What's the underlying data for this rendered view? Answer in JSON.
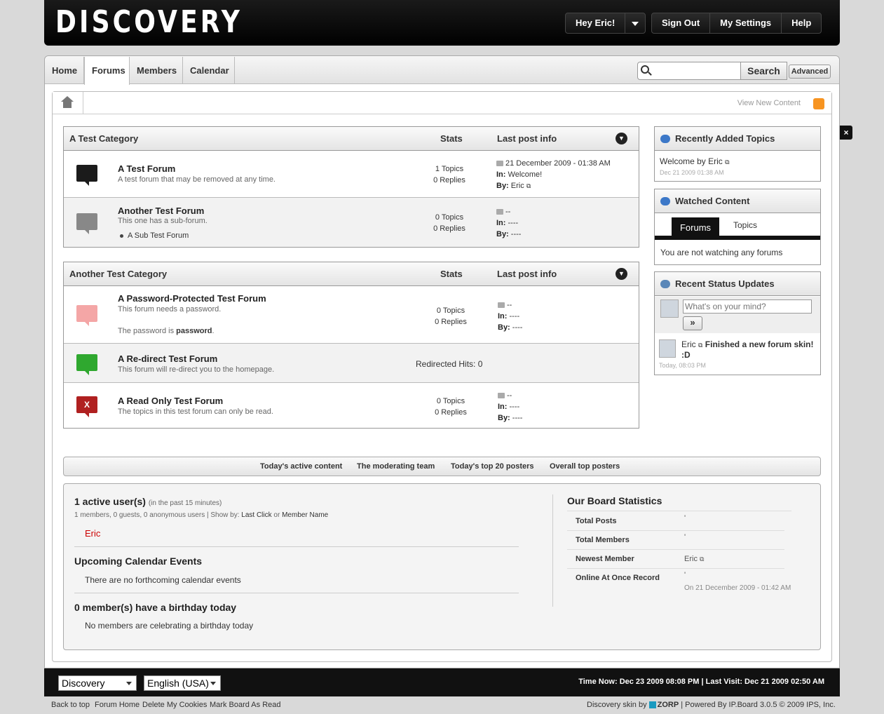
{
  "header": {
    "logo": "DISCOVERY",
    "greeting": "Hey Eric!",
    "sign_out": "Sign Out",
    "my_settings": "My Settings",
    "help": "Help"
  },
  "nav": {
    "tabs": [
      "Home",
      "Forums",
      "Members",
      "Calendar"
    ],
    "active": "Forums",
    "search_button": "Search",
    "advanced_button": "Advanced"
  },
  "breadcrumb": {
    "view_new": "View New Content"
  },
  "categories": [
    {
      "title": "A Test Category",
      "stats_label": "Stats",
      "last_label": "Last post info",
      "forums": [
        {
          "title": "A Test Forum",
          "desc": "A test forum that may be removed at any time.",
          "topics": "1 Topics",
          "replies": "0 Replies",
          "last_date": "21 December 2009 - 01:38 AM",
          "in_label": "In:",
          "in_value": "Welcome!",
          "by_label": "By:",
          "by_value": "Eric",
          "icon_color": "#1b1b1b"
        },
        {
          "title": "Another Test Forum",
          "desc": "This one has a sub-forum.",
          "sub": "A Sub Test Forum",
          "topics": "0 Topics",
          "replies": "0 Replies",
          "last_date": "--",
          "in_label": "In:",
          "in_value": "----",
          "by_label": "By:",
          "by_value": "----",
          "icon_color": "#888888"
        }
      ]
    },
    {
      "title": "Another Test Category",
      "stats_label": "Stats",
      "last_label": "Last post info",
      "forums": [
        {
          "title": "A Password-Protected Test Forum",
          "desc": "This forum needs a password.",
          "desc2_pre": "The password is ",
          "desc2_bold": "password",
          "desc2_post": ".",
          "topics": "0 Topics",
          "replies": "0 Replies",
          "last_date": "--",
          "in_label": "In:",
          "in_value": "----",
          "by_label": "By:",
          "by_value": "----",
          "icon_color": "#f4a6a6"
        },
        {
          "title": "A Re-direct Test Forum",
          "desc": "This forum will re-direct you to the homepage.",
          "redirect": "Redirected Hits: 0",
          "icon_color": "#2fa82f"
        },
        {
          "title": "A Read Only Test Forum",
          "desc": "The topics in this test forum can only be read.",
          "topics": "0 Topics",
          "replies": "0 Replies",
          "last_date": "--",
          "in_label": "In:",
          "in_value": "----",
          "by_label": "By:",
          "by_value": "----",
          "icon_color": "#b02020",
          "icon_mark": "X"
        }
      ]
    }
  ],
  "sidebar": {
    "recent": {
      "title": "Recently Added Topics",
      "topic": "Welcome",
      "by": " by Eric",
      "date": "Dec 21 2009 01:38 AM"
    },
    "watched": {
      "title": "Watched Content",
      "tab_forums": "Forums",
      "tab_topics": "Topics",
      "empty": "You are not watching any forums"
    },
    "status": {
      "title": "Recent Status Updates",
      "placeholder": "What's on your mind?",
      "submit": "»",
      "user": "Eric",
      "text": "Finished a new forum skin! :D",
      "date": "Today, 08:03 PM"
    }
  },
  "statbar": [
    "Today's active content",
    "The moderating team",
    "Today's top 20 posters",
    "Overall top posters"
  ],
  "board": {
    "active_title": "1 active user(s)",
    "active_sub": "(in the past 15 minutes)",
    "active_detail_pre": "1 members, 0 guests, 0 anonymous users | Show by: ",
    "active_detail_last": "Last Click",
    "active_detail_or": " or ",
    "active_detail_name": "Member Name",
    "active_user": "Eric",
    "cal_title": "Upcoming Calendar Events",
    "cal_empty": "There are no forthcoming calendar events",
    "bday_title": "0 member(s) have a birthday today",
    "bday_empty": "No members are celebrating a birthday today",
    "stats_title": "Our Board Statistics",
    "stats": [
      {
        "label": "Total Posts",
        "value": "'"
      },
      {
        "label": "Total Members",
        "value": "'"
      },
      {
        "label": "Newest Member",
        "value": "Eric"
      },
      {
        "label": "Online At Once Record",
        "value": "'",
        "extra": "On 21 December 2009 - 01:42 AM"
      }
    ]
  },
  "footer": {
    "skin": "Discovery",
    "language": "English (USA)",
    "time": "Time Now: Dec 23 2009 08:08 PM | Last Visit: Dec 21 2009 02:50 AM"
  },
  "bottom_links": [
    "Back to top",
    "Forum Home",
    "Delete My Cookies",
    "Mark Board As Read"
  ],
  "credits": {
    "pre": "Discovery skin by ",
    "zorp": "ZORP",
    "post": " | Powered By IP.Board 3.0.5 © 2009  IPS, Inc."
  },
  "close": "×"
}
